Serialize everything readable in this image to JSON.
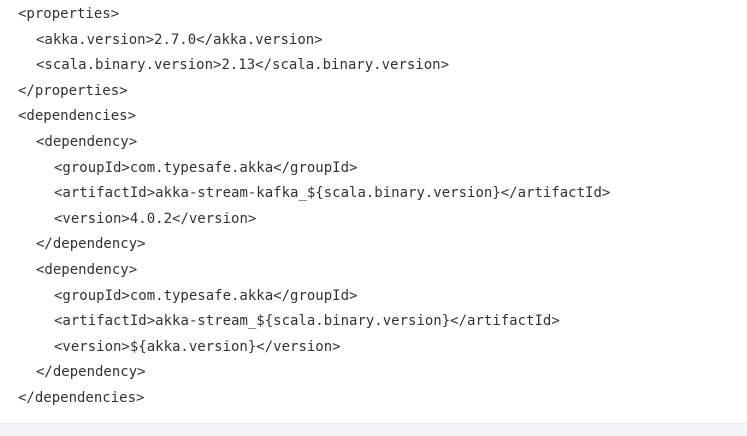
{
  "code": {
    "language": "xml",
    "lines": [
      {
        "open": "<properties>"
      },
      {
        "open": "<akka.version>",
        "value": "2.7.0",
        "close": "</akka.version>"
      },
      {
        "open": "<scala.binary.version>",
        "value": "2.13",
        "close": "</scala.binary.version>"
      },
      {
        "open": "</properties>"
      },
      {
        "open": "<dependencies>"
      },
      {
        "open": "<dependency>"
      },
      {
        "open": "<groupId>",
        "value": "com.typesafe.akka",
        "close": "</groupId>"
      },
      {
        "open": "<artifactId>",
        "value": "akka-stream-kafka_${scala.binary.version}",
        "close": "</artifactId>"
      },
      {
        "open": "<version>",
        "value": "4.0.2",
        "close": "</version>"
      },
      {
        "open": "</dependency>"
      },
      {
        "open": "<dependency>"
      },
      {
        "open": "<groupId>",
        "value": "com.typesafe.akka",
        "close": "</groupId>"
      },
      {
        "open": "<artifactId>",
        "value": "akka-stream_${scala.binary.version}",
        "close": "</artifactId>"
      },
      {
        "open": "<version>",
        "value": "${akka.version}",
        "close": "</version>"
      },
      {
        "open": "</dependency>"
      },
      {
        "open": "</dependencies>"
      }
    ]
  },
  "colors": {
    "page_background": "#f4f5f6",
    "code_background": "#ffffff",
    "code_text": "#2f3337"
  }
}
